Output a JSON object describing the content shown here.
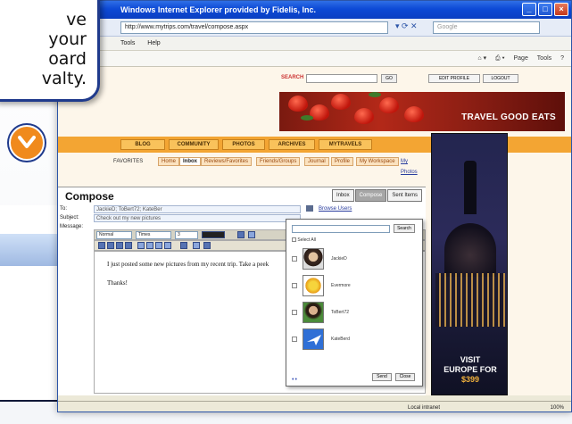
{
  "callout": {
    "lines": [
      "ve",
      "your",
      "oard",
      "valty."
    ]
  },
  "window": {
    "title": "Windows Internet Explorer provided by Fidelis, Inc.",
    "address": "http://www.mytrips.com/travel/compose.aspx",
    "search_placeholder": "Google",
    "menu": [
      "Tools",
      "Help"
    ],
    "toolbar": [
      "Page",
      "Tools"
    ]
  },
  "site": {
    "search_label": "SEARCH",
    "go_label": "GO",
    "edit_profile": "EDIT PROFILE",
    "logout": "LOGOUT",
    "banner_text": "TRAVEL GOOD EATS",
    "nav": [
      "BLOG",
      "COMMUNITY",
      "PHOTOS",
      "ARCHIVES",
      "MYTRAVELS"
    ],
    "subnav_left": "FAVORITES",
    "subnav": [
      "Home",
      "Inbox",
      "Reviews/Favorites",
      "Friends/Groups",
      "Journal",
      "Profile",
      "My Workspace"
    ],
    "subnav_link": "My Photos"
  },
  "compose": {
    "title": "Compose",
    "tabs": [
      "Inbox",
      "Compose",
      "Sent Items"
    ],
    "to_label": "To:",
    "to_value": "JackieD; ToBert72; KateBer",
    "subject_label": "Subject:",
    "subject_value": "Check out my new pictures",
    "message_label": "Message:",
    "browse_label": "Browse Users",
    "font_style": "Normal",
    "font_face": "Times",
    "font_size": "3",
    "body_line1": "I just posted some new pictures from my recent trip.  Take a peek",
    "body_line2": "Thanks!"
  },
  "popup": {
    "search_button": "Search",
    "select_all": "Select All",
    "contacts": [
      {
        "name": "JackieD"
      },
      {
        "name": "Evermore"
      },
      {
        "name": "ToBert72"
      },
      {
        "name": "KateBerd"
      }
    ],
    "send_button": "Send",
    "close_button": "Close"
  },
  "ad": {
    "line1": "VISIT",
    "line2": "EUROPE FOR",
    "price": "$399"
  },
  "status": {
    "zone": "Local intranet",
    "zoom": "100%"
  }
}
